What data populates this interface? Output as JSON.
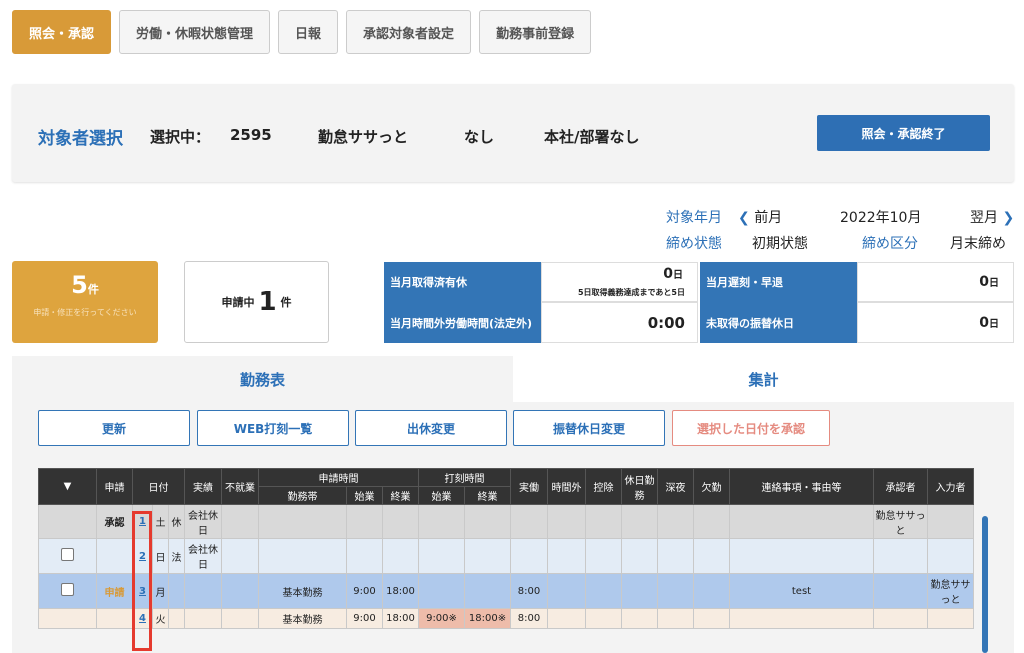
{
  "tabs": [
    "照会・承認",
    "労働・休暇状態管理",
    "日報",
    "承認対象者設定",
    "勤務事前登録"
  ],
  "target": {
    "title": "対象者選択",
    "selected_label": "選択中：",
    "employee_id": "2595",
    "employee_name": "勤怠ササっと",
    "flag": "なし",
    "department": "本社/部署なし",
    "end_button": "照会・承認終了"
  },
  "month": {
    "year_month_label": "対象年月",
    "prev": "前月",
    "current": "2022年10月",
    "next": "翌月",
    "close_state_label": "締め状態",
    "close_state_value": "初期状態",
    "close_kind_label": "締め区分",
    "close_kind_value": "月末締め"
  },
  "summary": {
    "count": "5",
    "count_unit": "件",
    "count_sub": "申請・修正を行ってください",
    "pending_label": "申請中",
    "pending_count": "1",
    "pending_unit": "件",
    "leave_taken_label": "当月取得済有休",
    "leave_taken_value": "0",
    "leave_taken_unit": "日",
    "leave_taken_note": "5日取得義務達成まであと5日",
    "late_label": "当月遅刻・早退",
    "late_value": "0",
    "late_unit": "日",
    "overtime_label": "当月時間外労働時間(法定外)",
    "overtime_value": "0:00",
    "untaken_label": "未取得の振替休日",
    "untaken_value": "0",
    "untaken_unit": "日"
  },
  "panel_tabs": {
    "active": "勤務表",
    "inactive": "集計"
  },
  "actions": [
    "更新",
    "WEB打刻一覧",
    "出休変更",
    "振替休日変更",
    "選択した日付を承認"
  ],
  "table": {
    "headers_top": [
      "▼",
      "申請",
      "日付",
      "実績",
      "不就業",
      "申請時間",
      "打刻時間",
      "実働",
      "時間外",
      "控除",
      "休日勤務",
      "深夜",
      "欠勤",
      "連絡事項・事由等",
      "承認者",
      "入力者"
    ],
    "headers_sub": [
      "勤務帯",
      "始業",
      "終業",
      "始業",
      "終業"
    ],
    "rows": [
      {
        "status": "承認",
        "day": "1",
        "dow": "土",
        "kind": "休",
        "actual": "会社休日",
        "shift": "",
        "start": "",
        "end": "",
        "pstart": "",
        "pend": "",
        "work": "",
        "note": "",
        "approver": "勤怠ササっと",
        "inputter": ""
      },
      {
        "status": "",
        "day": "2",
        "dow": "日",
        "kind": "法",
        "actual": "会社休日",
        "shift": "",
        "start": "",
        "end": "",
        "pstart": "",
        "pend": "",
        "work": "",
        "note": "",
        "approver": "",
        "inputter": ""
      },
      {
        "status": "申請",
        "day": "3",
        "dow": "月",
        "kind": "",
        "actual": "",
        "shift": "基本勤務",
        "start": "9:00",
        "end": "18:00",
        "pstart": "",
        "pend": "",
        "work": "8:00",
        "note": "test",
        "approver": "",
        "inputter": "勤怠ササっと"
      },
      {
        "status": "",
        "day": "4",
        "dow": "火",
        "kind": "",
        "actual": "",
        "shift": "基本勤務",
        "start": "9:00",
        "end": "18:00",
        "pstart": "9:00※",
        "pend": "18:00※",
        "work": "8:00",
        "note": "",
        "approver": "",
        "inputter": ""
      }
    ]
  }
}
